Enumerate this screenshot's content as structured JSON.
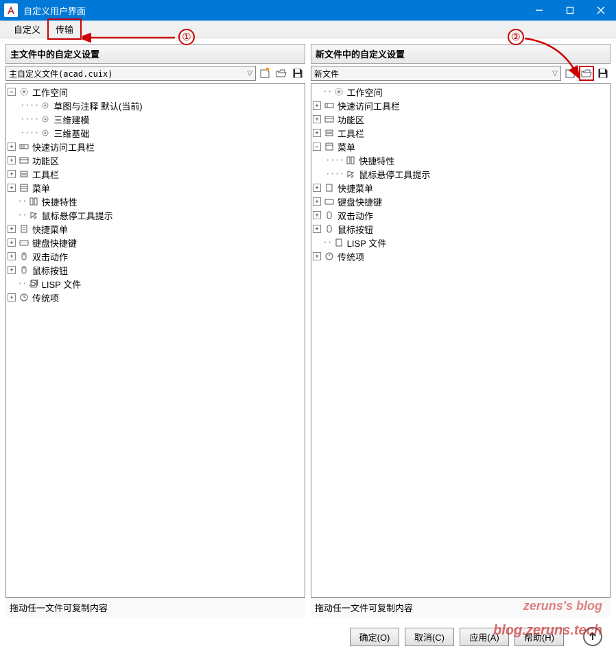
{
  "window": {
    "title": "自定义用户界面",
    "app_letter": "A"
  },
  "tabs": {
    "t1": "自定义",
    "t2": "传输"
  },
  "left": {
    "header": "主文件中的自定义设置",
    "dropdown": "主自定义文件(acad.cuix)",
    "footer": "拖动任一文件可复制内容",
    "tree": {
      "workspace": "工作空间",
      "ws1": "草图与注释 默认(当前)",
      "ws2": "三维建模",
      "ws3": "三维基础",
      "quick_access": "快速访问工具栏",
      "ribbon": "功能区",
      "toolbar": "工具栏",
      "menu": "菜单",
      "quick_props": "快捷特性",
      "hover_tip": "鼠标悬停工具提示",
      "shortcut_menu": "快捷菜单",
      "keyboard": "键盘快捷键",
      "dblclick": "双击动作",
      "mouse_btn": "鼠标按钮",
      "lisp": "LISP 文件",
      "legacy": "传统项"
    }
  },
  "right": {
    "header": "新文件中的自定义设置",
    "dropdown": "新文件",
    "footer": "拖动任一文件可复制内容",
    "tree": {
      "workspace": "工作空间",
      "quick_access": "快速访问工具栏",
      "ribbon": "功能区",
      "toolbar": "工具栏",
      "menu": "菜单",
      "quick_props": "快捷特性",
      "hover_tip": "鼠标悬停工具提示",
      "shortcut_menu": "快捷菜单",
      "keyboard": "键盘快捷键",
      "dblclick": "双击动作",
      "mouse_btn": "鼠标按钮",
      "lisp": "LISP 文件",
      "legacy": "传统项"
    }
  },
  "buttons": {
    "ok": "确定(O)",
    "cancel": "取消(C)",
    "apply": "应用(A)",
    "help": "帮助(H)"
  },
  "annotations": {
    "n1": "①",
    "n2": "②"
  },
  "watermarks": {
    "w1": "zeruns's blog",
    "w2": "blog.zeruns.tech"
  }
}
